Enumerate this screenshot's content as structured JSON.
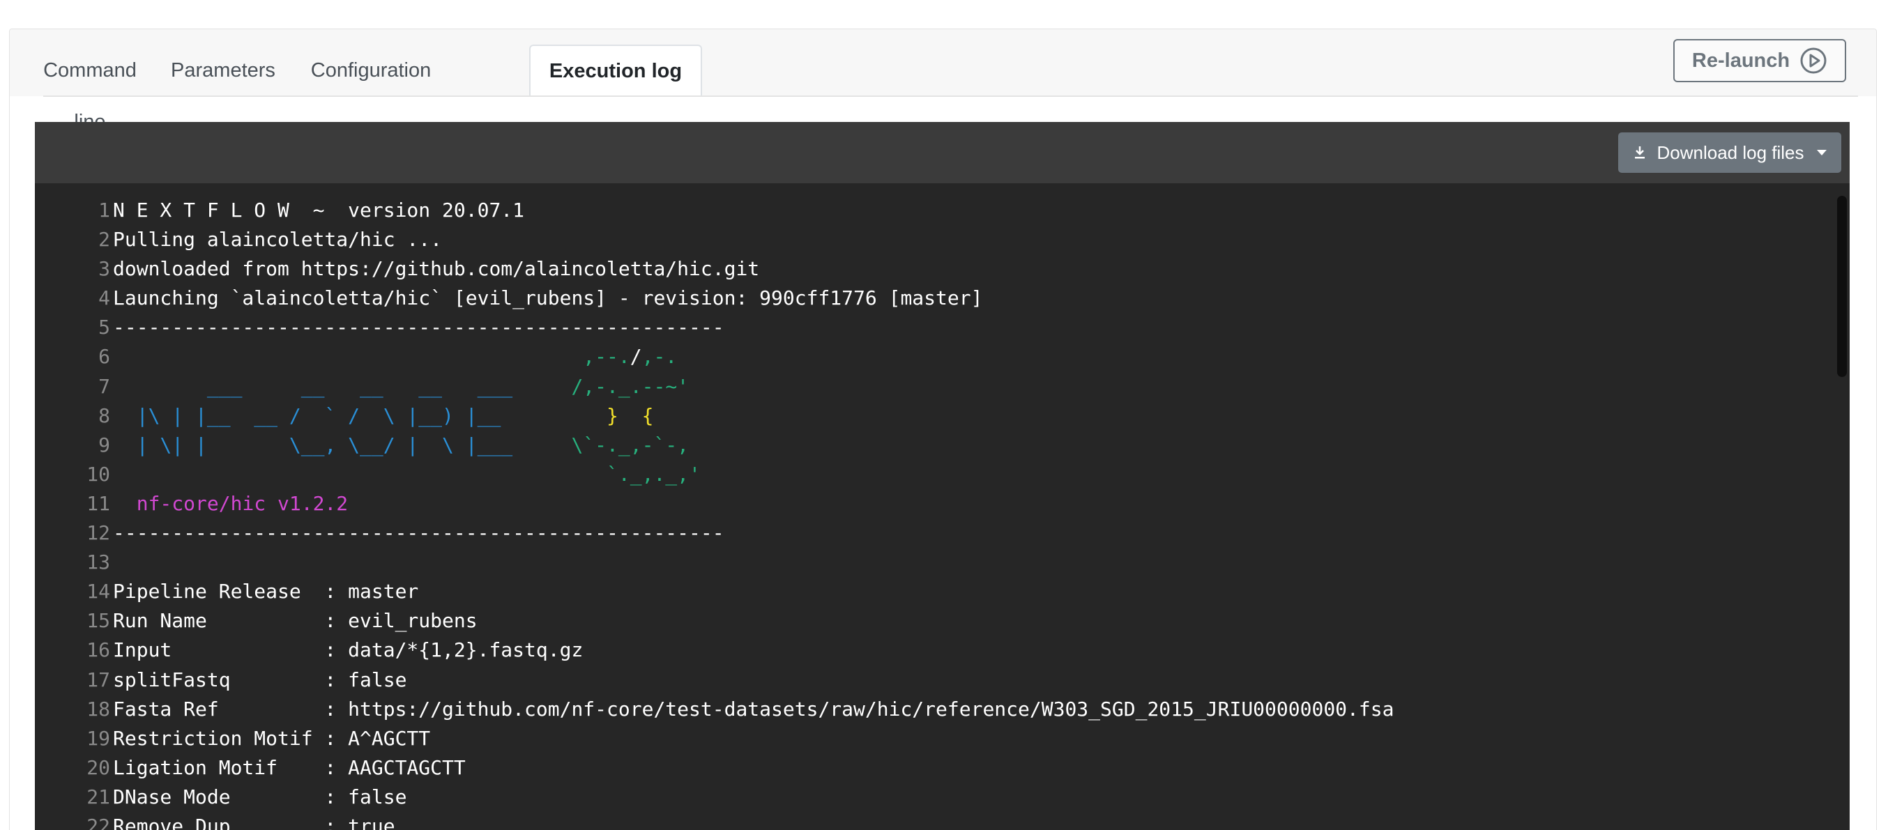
{
  "tabs": [
    {
      "label": "Command line"
    },
    {
      "label": "Parameters"
    },
    {
      "label": "Configuration"
    },
    {
      "label": "Execution log"
    }
  ],
  "relaunch_label": "Re-launch",
  "download_label": "Download log files",
  "colors": {
    "console_bg": "#262626",
    "nfcore_blue": "#2a8fd6",
    "nfcore_green": "#27b07d",
    "nfcore_yellow": "#f2e02b",
    "nfcore_magenta": "#d148d1"
  },
  "log_lines": [
    {
      "n": "1",
      "segs": [
        [
          "w",
          "N E X T F L O W  ~  version 20.07.1"
        ]
      ]
    },
    {
      "n": "2",
      "segs": [
        [
          "w",
          "Pulling alaincoletta/hic ..."
        ]
      ]
    },
    {
      "n": "3",
      "segs": [
        [
          "w",
          "downloaded from https://github.com/alaincoletta/hic.git"
        ]
      ]
    },
    {
      "n": "4",
      "segs": [
        [
          "w",
          "Launching `alaincoletta/hic` [evil_rubens] - revision: 990cff1776 [master]"
        ]
      ]
    },
    {
      "n": "5",
      "segs": [
        [
          "w",
          "----------------------------------------------------"
        ]
      ]
    },
    {
      "n": "6",
      "segs": [
        [
          "w",
          "                                        "
        ],
        [
          "g",
          ",--."
        ],
        [
          "w",
          "/"
        ],
        [
          "g",
          ",-."
        ]
      ]
    },
    {
      "n": "7",
      "segs": [
        [
          "b",
          "        ___     __   __   __   ___     "
        ],
        [
          "g",
          "/,-._.--~'"
        ]
      ]
    },
    {
      "n": "8",
      "segs": [
        [
          "b",
          "  |\\ | |__  __ /  ` /  \\ |__) |__         "
        ],
        [
          "y",
          "}  {"
        ]
      ]
    },
    {
      "n": "9",
      "segs": [
        [
          "b",
          "  | \\| |       \\__, \\__/ |  \\ |___     "
        ],
        [
          "g",
          "\\`-._,-`-,"
        ]
      ]
    },
    {
      "n": "10",
      "segs": [
        [
          "g",
          "                                          `._,._,'"
        ]
      ]
    },
    {
      "n": "11",
      "segs": [
        [
          "m",
          "  nf-core/hic v1.2.2"
        ]
      ]
    },
    {
      "n": "12",
      "segs": [
        [
          "w",
          "----------------------------------------------------"
        ]
      ]
    },
    {
      "n": "13",
      "segs": [
        [
          "w",
          ""
        ]
      ]
    },
    {
      "n": "14",
      "segs": [
        [
          "w",
          "Pipeline Release  : master"
        ]
      ]
    },
    {
      "n": "15",
      "segs": [
        [
          "w",
          "Run Name          : evil_rubens"
        ]
      ]
    },
    {
      "n": "16",
      "segs": [
        [
          "w",
          "Input             : data/*{1,2}.fastq.gz"
        ]
      ]
    },
    {
      "n": "17",
      "segs": [
        [
          "w",
          "splitFastq        : false"
        ]
      ]
    },
    {
      "n": "18",
      "segs": [
        [
          "w",
          "Fasta Ref         : https://github.com/nf-core/test-datasets/raw/hic/reference/W303_SGD_2015_JRIU00000000.fsa"
        ]
      ]
    },
    {
      "n": "19",
      "segs": [
        [
          "w",
          "Restriction Motif : A^AGCTT"
        ]
      ]
    },
    {
      "n": "20",
      "segs": [
        [
          "w",
          "Ligation Motif    : AAGCTAGCTT"
        ]
      ]
    },
    {
      "n": "21",
      "segs": [
        [
          "w",
          "DNase Mode        : false"
        ]
      ]
    },
    {
      "n": "22",
      "segs": [
        [
          "w",
          "Remove Dup        : true"
        ]
      ]
    }
  ]
}
